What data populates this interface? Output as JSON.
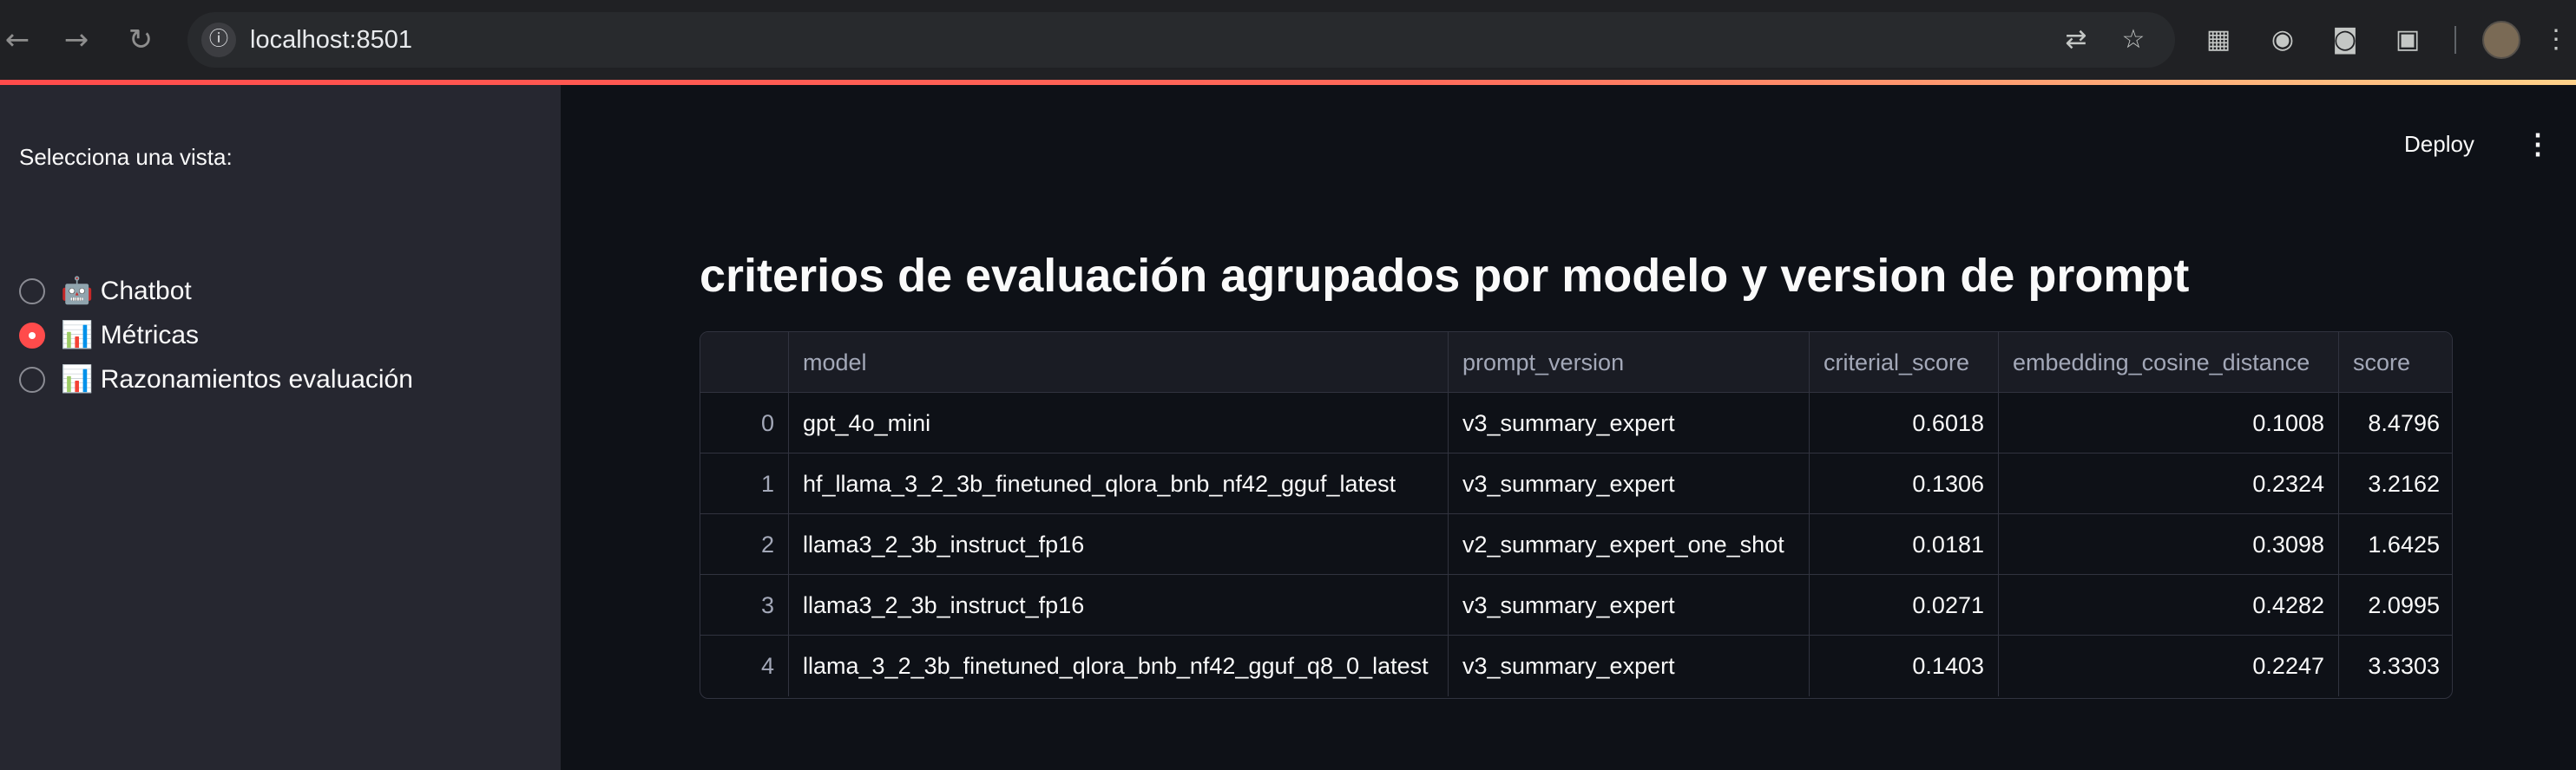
{
  "browser": {
    "url": "localhost:8501",
    "icons": [
      "back-arrow-icon",
      "forward-arrow-icon",
      "reload-icon",
      "site-info-icon",
      "translate-icon",
      "bookmark-star-icon",
      "qr-code-icon",
      "extension-icon",
      "extension-icon",
      "puzzle-icon",
      "profile-avatar",
      "kebab-menu-icon"
    ]
  },
  "sidebar": {
    "label": "Selecciona una vista:",
    "options": [
      {
        "label": "🤖 Chatbot",
        "selected": false
      },
      {
        "label": "📊 Métricas",
        "selected": true
      },
      {
        "label": "📊 Razonamientos evaluación",
        "selected": false
      }
    ]
  },
  "header": {
    "deploy_label": "Deploy"
  },
  "main": {
    "title": "criterios de evaluación agrupados por modelo y version de prompt"
  },
  "table": {
    "columns": [
      "",
      "model",
      "prompt_version",
      "criterial_score",
      "embedding_cosine_distance",
      "score"
    ],
    "rows": [
      [
        "0",
        "gpt_4o_mini",
        "v3_summary_expert",
        "0.6018",
        "0.1008",
        "8.4796"
      ],
      [
        "1",
        "hf_llama_3_2_3b_finetuned_qlora_bnb_nf42_gguf_latest",
        "v3_summary_expert",
        "0.1306",
        "0.2324",
        "3.2162"
      ],
      [
        "2",
        "llama3_2_3b_instruct_fp16",
        "v2_summary_expert_one_shot",
        "0.0181",
        "0.3098",
        "1.6425"
      ],
      [
        "3",
        "llama3_2_3b_instruct_fp16",
        "v3_summary_expert",
        "0.0271",
        "0.4282",
        "2.0995"
      ],
      [
        "4",
        "llama_3_2_3b_finetuned_qlora_bnb_nf42_gguf_q8_0_latest",
        "v3_summary_expert",
        "0.1403",
        "0.2247",
        "3.3303"
      ]
    ]
  },
  "colors": {
    "accent": "#ff4b4b",
    "sidebar_bg": "#262730",
    "main_bg": "#0e1117",
    "text": "#fafafa"
  }
}
